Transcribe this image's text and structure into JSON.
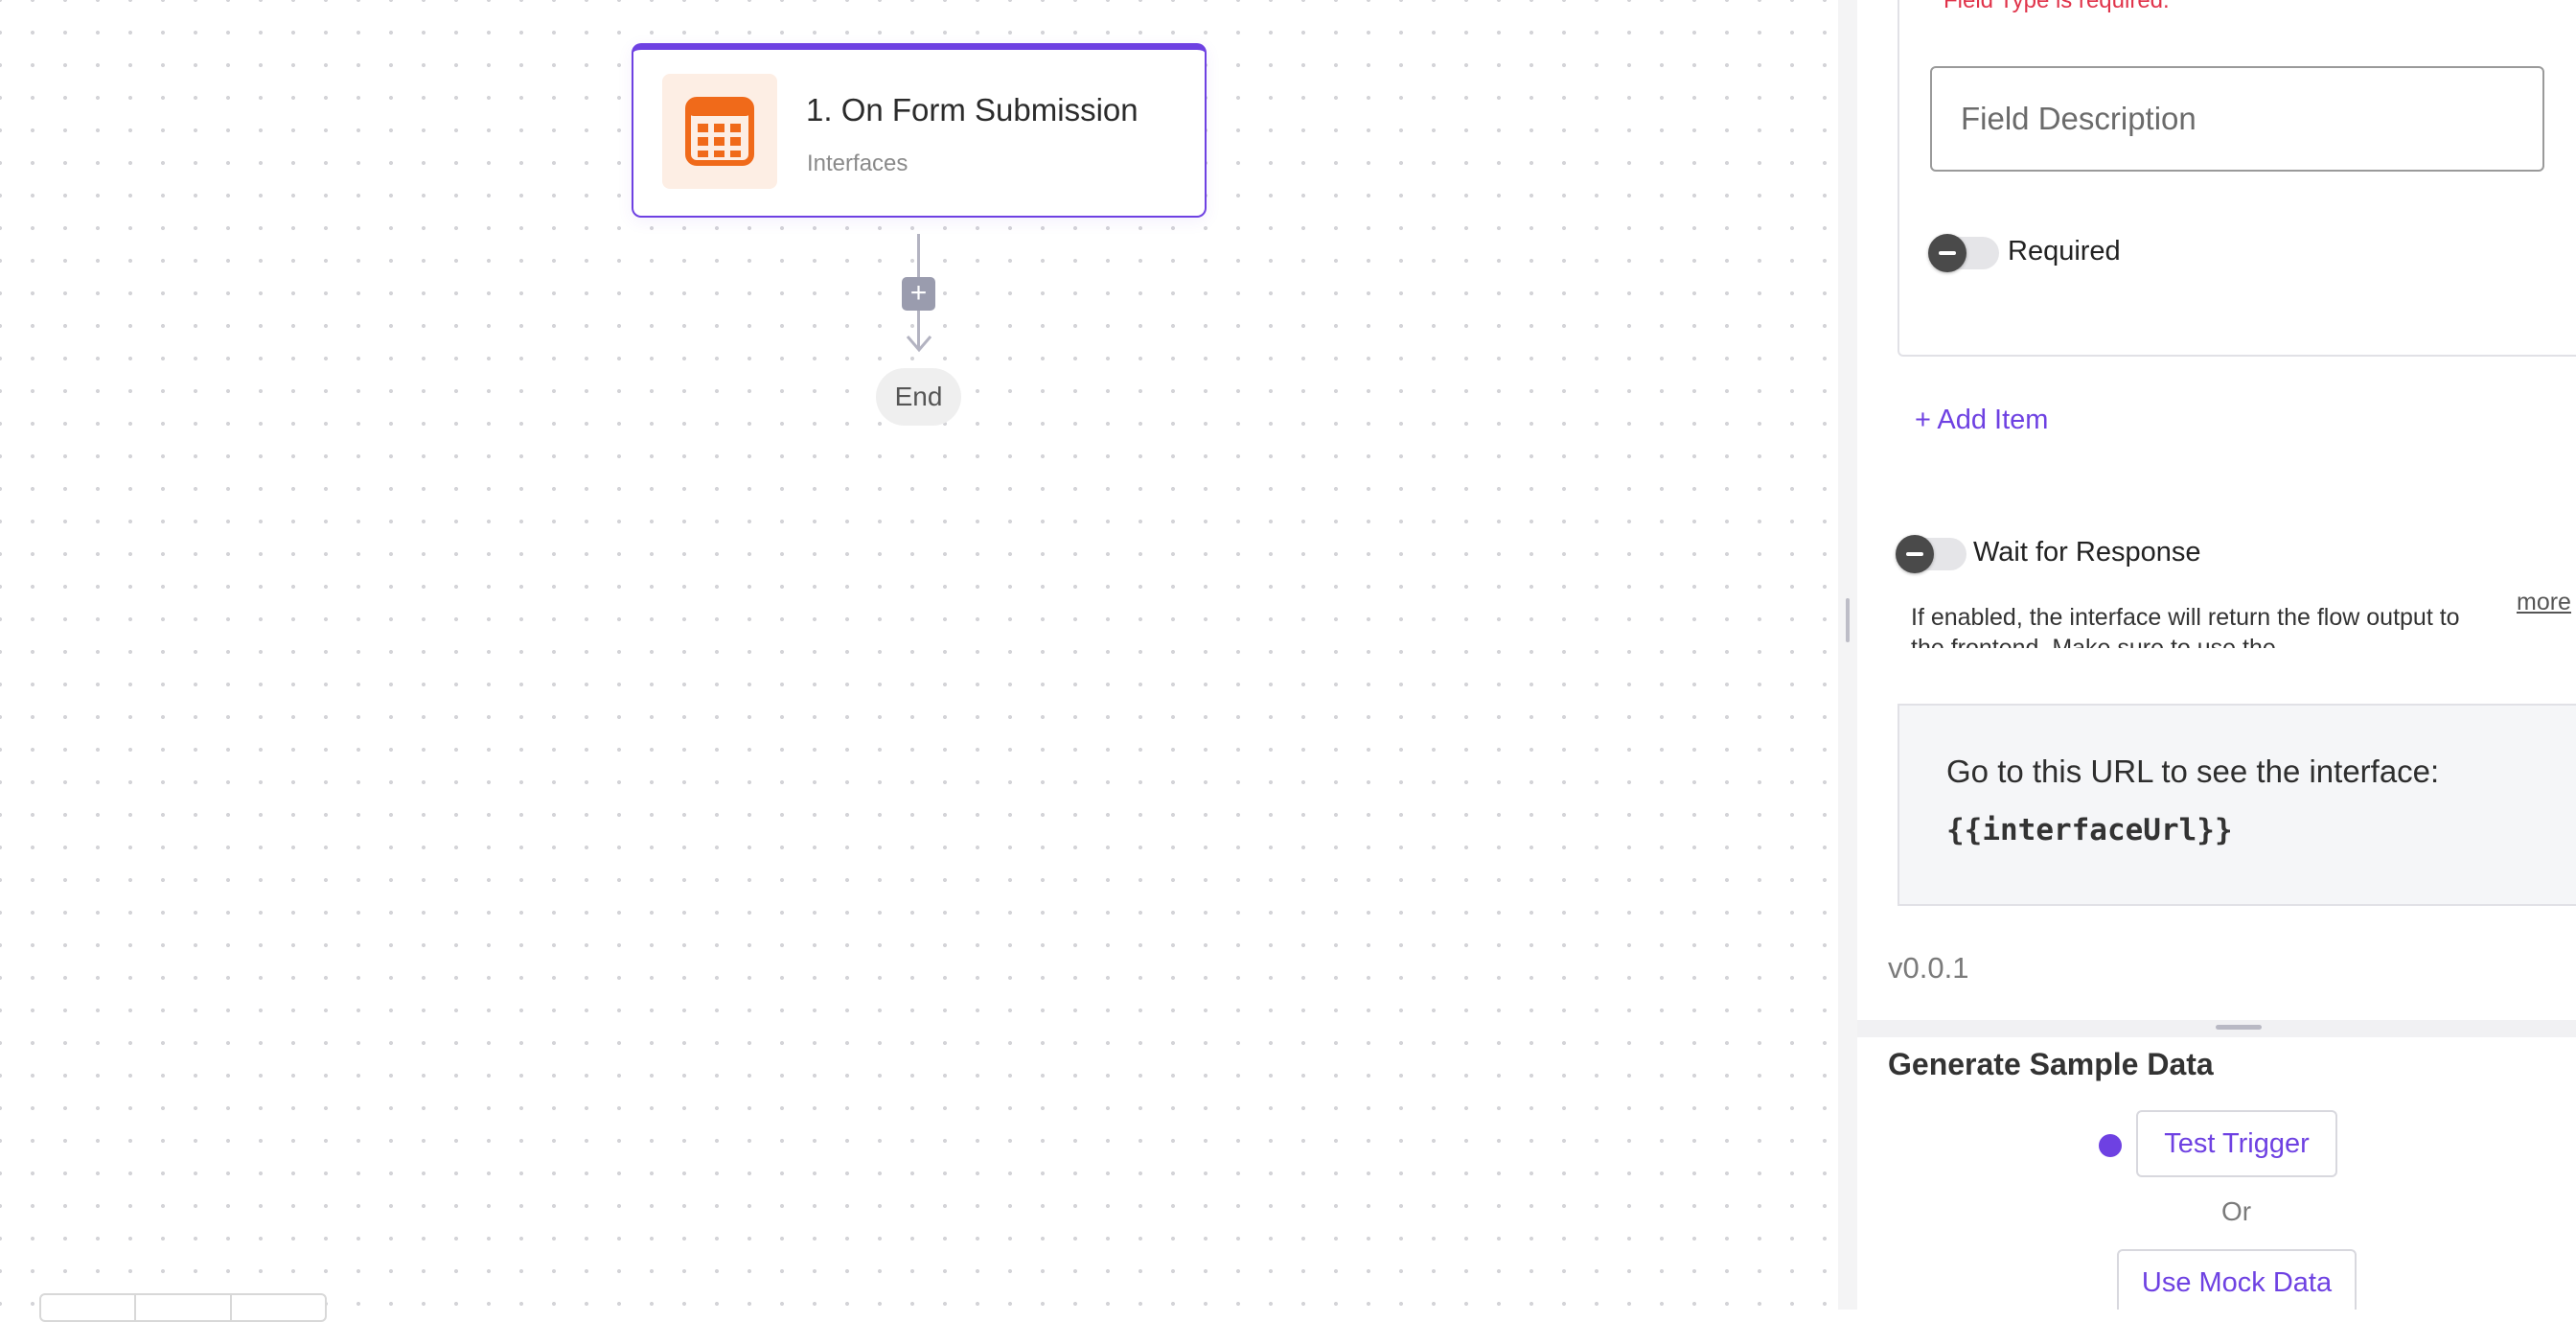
{
  "canvas": {
    "trigger_node": {
      "title": "1. On Form Submission",
      "subtitle": "Interfaces",
      "icon": "calculator-icon",
      "icon_color": "#f06a1a",
      "accent_color": "#6e41e2"
    },
    "add_step_symbol": "+",
    "end_label": "End"
  },
  "panel": {
    "error_text": "Field Type is required.",
    "field_description": {
      "placeholder": "Field Description",
      "value": ""
    },
    "required_toggle": {
      "label": "Required",
      "enabled": false
    },
    "add_item_label": "+ Add Item",
    "wait_toggle": {
      "label": "Wait for Response",
      "enabled": false
    },
    "wait_help_text": "If enabled, the interface will return the flow output to the frontend. Make sure to use the",
    "more_label": "more",
    "url_box": {
      "label": "Go to this URL to see the interface:",
      "code": "{{interfaceUrl}}"
    },
    "version": "v0.0.1"
  },
  "sample_data": {
    "title": "Generate Sample Data",
    "test_trigger_label": "Test Trigger",
    "or_label": "Or",
    "mock_data_label": "Use Mock Data",
    "status_color": "#6e41e2"
  }
}
